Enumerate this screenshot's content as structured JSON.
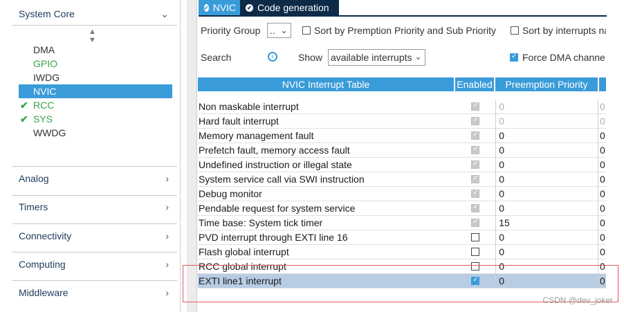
{
  "sidebar": {
    "categories": [
      {
        "label": "System Core",
        "expanded": true
      },
      {
        "label": "Analog"
      },
      {
        "label": "Timers"
      },
      {
        "label": "Connectivity"
      },
      {
        "label": "Computing"
      },
      {
        "label": "Middleware"
      }
    ],
    "system_core_items": [
      {
        "label": "DMA",
        "state": "normal"
      },
      {
        "label": "GPIO",
        "state": "green"
      },
      {
        "label": "IWDG",
        "state": "normal"
      },
      {
        "label": "NVIC",
        "state": "selected"
      },
      {
        "label": "RCC",
        "state": "checked"
      },
      {
        "label": "SYS",
        "state": "checked"
      },
      {
        "label": "WWDG",
        "state": "normal"
      }
    ]
  },
  "tabs": [
    {
      "label": "NVIC",
      "active": true
    },
    {
      "label": "Code generation",
      "active": false
    }
  ],
  "toolbar": {
    "priority_group_label": "Priority Group",
    "priority_group_value": "..",
    "sort_premption_label": "Sort by Premption Priority and Sub Priority",
    "sort_interrupts_label": "Sort by interrupts na",
    "search_label": "Search",
    "show_label": "Show",
    "show_value": "available interrupts",
    "force_dma_label": "Force DMA channe"
  },
  "table": {
    "headers": [
      "NVIC Interrupt Table",
      "Enabled",
      "Preemption Priority"
    ],
    "rows": [
      {
        "name": "Non maskable interrupt",
        "enabled": "locked",
        "preemption": "0",
        "sub": "0",
        "disabled": true
      },
      {
        "name": "Hard fault interrupt",
        "enabled": "locked",
        "preemption": "0",
        "sub": "0",
        "disabled": true
      },
      {
        "name": "Memory management fault",
        "enabled": "locked",
        "preemption": "0",
        "sub": "0",
        "disabled": false
      },
      {
        "name": "Prefetch fault, memory access fault",
        "enabled": "locked",
        "preemption": "0",
        "sub": "0",
        "disabled": false
      },
      {
        "name": "Undefined instruction or illegal state",
        "enabled": "locked",
        "preemption": "0",
        "sub": "0",
        "disabled": false
      },
      {
        "name": "System service call via SWI instruction",
        "enabled": "locked",
        "preemption": "0",
        "sub": "0",
        "disabled": false
      },
      {
        "name": "Debug monitor",
        "enabled": "locked",
        "preemption": "0",
        "sub": "0",
        "disabled": false
      },
      {
        "name": "Pendable request for system service",
        "enabled": "locked",
        "preemption": "0",
        "sub": "0",
        "disabled": false
      },
      {
        "name": "Time base: System tick timer",
        "enabled": "locked",
        "preemption": "15",
        "sub": "0",
        "disabled": false
      },
      {
        "name": "PVD interrupt through EXTI line 16",
        "enabled": "off",
        "preemption": "0",
        "sub": "0",
        "disabled": false
      },
      {
        "name": "Flash global interrupt",
        "enabled": "off",
        "preemption": "0",
        "sub": "0",
        "disabled": false
      },
      {
        "name": "RCC global interrupt",
        "enabled": "off",
        "preemption": "0",
        "sub": "0",
        "disabled": false
      },
      {
        "name": "EXTI line1 interrupt",
        "enabled": "on",
        "preemption": "0",
        "sub": "0",
        "disabled": false,
        "selected": true
      }
    ]
  },
  "watermark": "CSDN @dev_joker",
  "colors": {
    "accent": "#3a9bd9",
    "dark_tab": "#0d2b48",
    "green": "#3aa34a",
    "selected_row": "#b8cde4",
    "highlight_frame": "#e05a5a"
  }
}
